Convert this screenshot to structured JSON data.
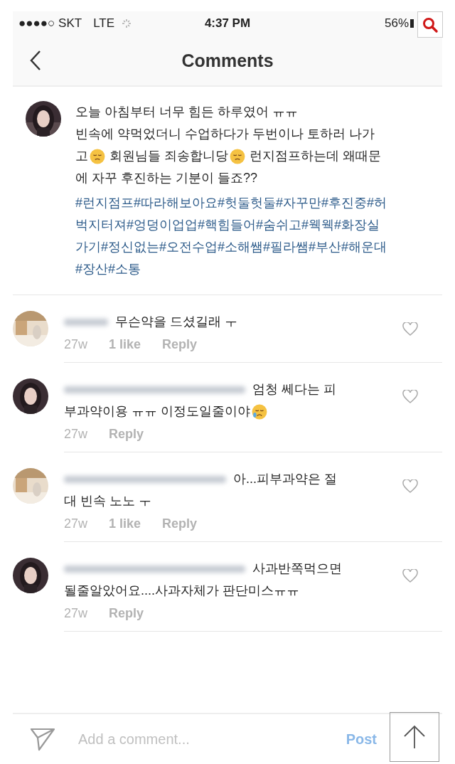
{
  "status_bar": {
    "carrier": "●●●●○ SKT",
    "network": "LTE",
    "time": "4:37 PM",
    "battery": "56%"
  },
  "nav": {
    "title": "Comments"
  },
  "caption": {
    "lines": [
      [
        {
          "kind": "text",
          "text": "오늘 아침부터 너무 힘든 하루였어 ㅠㅠ"
        }
      ],
      [
        {
          "kind": "text",
          "text": "빈속에 약먹었더니 수업하다가 두번이나 토하러 나가"
        }
      ],
      [
        {
          "kind": "text",
          "text": "고"
        },
        {
          "kind": "emoji"
        },
        {
          "kind": "text",
          "text": "회원님들 죄송합니당"
        },
        {
          "kind": "emoji"
        },
        {
          "kind": "text",
          "text": "런지점프하는데 왜때문"
        }
      ],
      [
        {
          "kind": "text",
          "text": "에 자꾸 후진하는 기분이 들죠??"
        }
      ]
    ],
    "hashtags": "#런지점프#따라해보아요#헛둘헛둘#자꾸만#후진중#허벅지터져#엉덩이업업#핵힘들어#숨쉬고#웩웩#화장실가기#정신없는#오전수업#소해쌤#필라쌤#부산#해운대#장산#소통"
  },
  "comments": [
    {
      "lines": [
        [
          {
            "kind": "text",
            "text": "무슨약을 드셨길래 ㅜ"
          }
        ]
      ],
      "time": "27w",
      "likes": "1 like",
      "reply": "Reply"
    },
    {
      "lines": [
        [
          {
            "kind": "text",
            "text": "엄청 쎄다는 피"
          }
        ],
        [
          {
            "kind": "text",
            "text": "부과약이용 ㅠㅠ 이정도일줄이야"
          },
          {
            "kind": "emoji"
          }
        ]
      ],
      "time": "27w",
      "reply": "Reply"
    },
    {
      "lines": [
        [
          {
            "kind": "text",
            "text": "아...피부과약은 절"
          }
        ],
        [
          {
            "kind": "text",
            "text": "대 빈속 노노 ㅜ"
          }
        ]
      ],
      "time": "27w",
      "likes": "1 like",
      "reply": "Reply"
    },
    {
      "lines": [
        [
          {
            "kind": "text",
            "text": "사과반쪽먹으면"
          }
        ],
        [
          {
            "kind": "text",
            "text": "될줄알았어요....사과자체가 판단미스ㅠㅠ"
          }
        ]
      ],
      "time": "27w",
      "reply": "Reply"
    }
  ],
  "composer": {
    "placeholder": "Add a comment...",
    "post_label": "Post",
    "post_disabled": true
  }
}
